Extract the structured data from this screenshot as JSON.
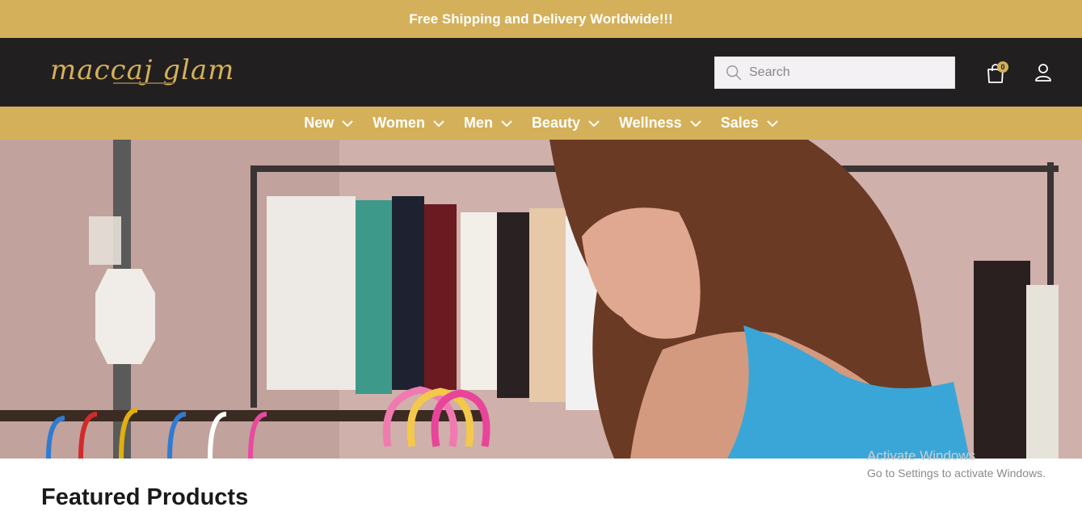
{
  "announcement": "Free Shipping and Delivery Worldwide!!!",
  "logo": {
    "text": "maccaj glam"
  },
  "search": {
    "placeholder": "Search"
  },
  "cart": {
    "count": "0"
  },
  "nav": [
    {
      "label": "New"
    },
    {
      "label": "Women"
    },
    {
      "label": "Men"
    },
    {
      "label": "Beauty"
    },
    {
      "label": "Wellness"
    },
    {
      "label": "Sales"
    }
  ],
  "hero": {
    "alt": "Woman browsing clothes on a rack"
  },
  "featured_title": "Featured Products",
  "watermark": {
    "title": "Activate Windows",
    "subtitle": "Go to Settings to activate Windows."
  },
  "colors": {
    "gold": "#d4b05a",
    "dark": "#221f20"
  }
}
